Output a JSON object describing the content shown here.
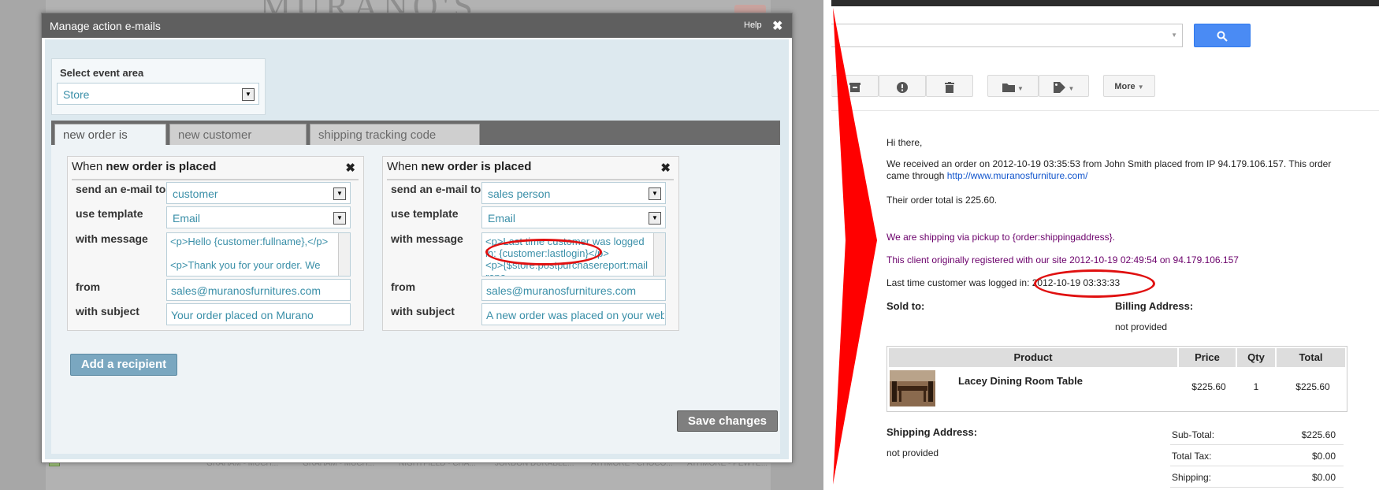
{
  "background": {
    "logo_text": "MURANO'S",
    "product_names": [
      "GRAHAM - MUCH...",
      "GRAHAM - MUCH...",
      "NIGHTFIELD - CHA...",
      "JORDON DURABLE...",
      "ATHMORE - CHOCO...",
      "ATHMORE - PEWTE..."
    ]
  },
  "dialog": {
    "title": "Manage action e-mails",
    "help": "Help",
    "close_glyph": "✖",
    "event_area": {
      "label": "Select event area",
      "value": "Store"
    },
    "tabs": [
      "new order is placed",
      "new customer registered",
      "shipping tracking code updated"
    ],
    "cards": [
      {
        "header_prefix": "When ",
        "header_event": "new order is placed",
        "labels": {
          "send_to": "send an e-mail to",
          "template": "use template",
          "message": "with message",
          "from": "from",
          "subject": "with subject"
        },
        "send_to": "customer",
        "template": "Email",
        "message": "<p>Hello {customer:fullname},</p>\n\n<p>Thank you for your order. We",
        "from": "sales@muranosfurnitures.com",
        "subject": "Your order placed on Murano"
      },
      {
        "header_prefix": "When ",
        "header_event": "new order is placed",
        "labels": {
          "send_to": "send an e-mail to",
          "template": "use template",
          "message": "with message",
          "from": "from",
          "subject": "with subject"
        },
        "send_to": "sales person",
        "template": "Email",
        "message": "<p>Last time customer was logged in: {customer:lastlogin}</p>\n<p>{$store:postpurchasereport:mailrepo",
        "from": "sales@muranosfurnitures.com",
        "subject": "A new order was placed on your websit"
      }
    ],
    "add_recipient": "Add a recipient",
    "save": "Save changes"
  },
  "gmail": {
    "search_button_icon": "search-icon",
    "toolbar": {
      "more": "More"
    },
    "email": {
      "greeting": "Hi there,",
      "line1": "We received an order on 2012-10-19 03:35:53 from John Smith placed from IP 94.179.106.157. This order came through ",
      "link": "http://www.muranosfurniture.com/",
      "total": "Their order total is 225.60.",
      "shipping_via": "We are shipping via pickup to {order:shippingaddress}.",
      "registered": "This client originally registered with our site 2012-10-19 02:49:54 on 94.179.106.157",
      "last_login": "Last time customer was logged in: 2012-10-19 03:33:33",
      "sold_to": "Sold to:",
      "billing_address": "Billing Address:",
      "billing_value": "not provided",
      "table": {
        "headers": [
          "Product",
          "Price",
          "Qty",
          "Total"
        ],
        "row": {
          "product": "Lacey Dining Room Table",
          "price": "$225.60",
          "qty": "1",
          "total": "$225.60"
        }
      },
      "shipping_address": "Shipping Address:",
      "shipping_value": "not provided",
      "totals": [
        {
          "label": "Sub-Total:",
          "value": "$225.60"
        },
        {
          "label": "Total Tax:",
          "value": "$0.00"
        },
        {
          "label": "Shipping:",
          "value": "$0.00"
        }
      ]
    }
  },
  "colors": {
    "annotation_red": "#e01010",
    "tab_strip": "#6b6b6b",
    "panel": "#dde9ef",
    "field_text": "#3a8fa8"
  }
}
